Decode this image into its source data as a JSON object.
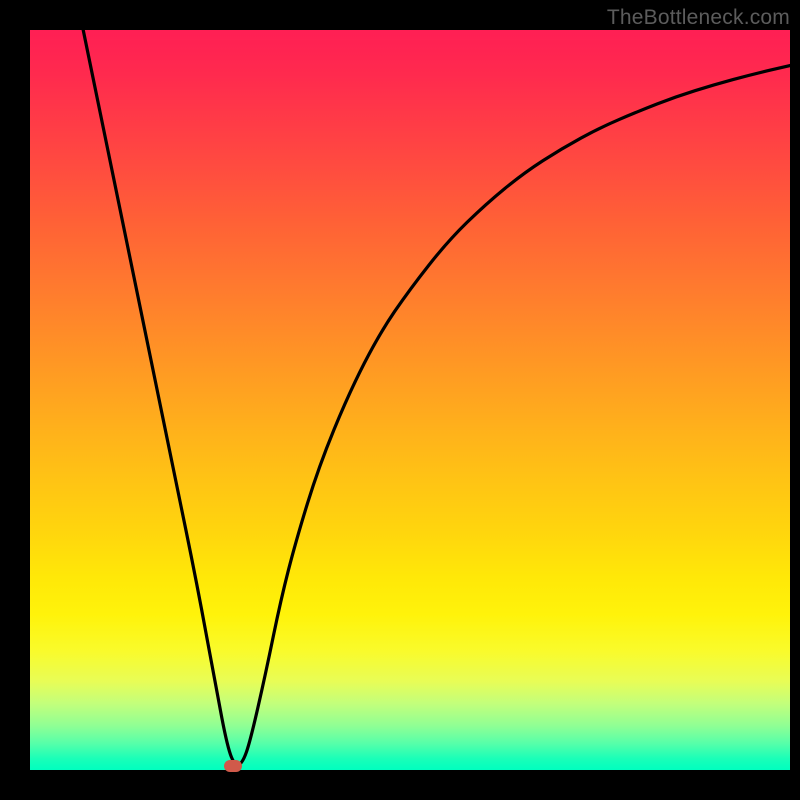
{
  "watermark": "TheBottleneck.com",
  "marker": {
    "cx_pct": 26.7,
    "cy_pct": 99.4
  },
  "chart_data": {
    "type": "line",
    "title": "",
    "xlabel": "",
    "ylabel": "",
    "xlim": [
      0,
      100
    ],
    "ylim": [
      0,
      100
    ],
    "annotations": [
      "TheBottleneck.com"
    ],
    "series": [
      {
        "name": "curve",
        "x": [
          7,
          10,
          13,
          16,
          19,
          22,
          24.5,
          26,
          27,
          28,
          29,
          31,
          33,
          35,
          38,
          42,
          46,
          50,
          55,
          60,
          65,
          70,
          75,
          80,
          85,
          90,
          95,
          100
        ],
        "y": [
          100,
          85,
          70,
          55,
          40,
          25,
          11,
          3,
          0.5,
          1,
          4,
          13,
          23,
          31,
          41,
          51,
          59,
          65,
          71.5,
          76.5,
          80.7,
          84,
          86.8,
          89,
          91,
          92.6,
          94,
          95.2
        ]
      }
    ],
    "gradient_stops": [
      {
        "pct": 0,
        "color": "#ff1f54"
      },
      {
        "pct": 50,
        "color": "#ffa81f"
      },
      {
        "pct": 80,
        "color": "#fff30a"
      },
      {
        "pct": 100,
        "color": "#00ffbf"
      }
    ]
  }
}
